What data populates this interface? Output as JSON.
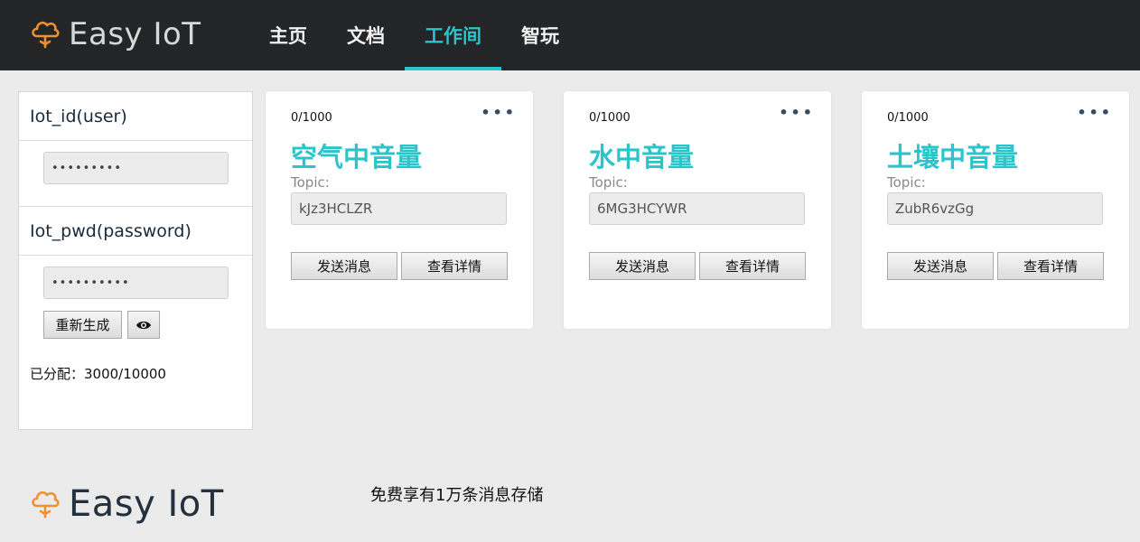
{
  "app": {
    "name": "Easy IoT",
    "brand_color": "#2cc4cb",
    "logo_color": "#f0902e"
  },
  "nav": {
    "items": [
      {
        "label": "主页",
        "active": false
      },
      {
        "label": "文档",
        "active": false
      },
      {
        "label": "工作间",
        "active": true
      },
      {
        "label": "智玩",
        "active": false
      }
    ]
  },
  "account": {
    "user_label": "Iot_id(user)",
    "user_value": "•••••••••",
    "pwd_label": "Iot_pwd(password)",
    "pwd_value": "••••••••••",
    "regenerate_label": "重新生成",
    "reveal_icon": "eye-icon",
    "allocation_text": "已分配：3000/10000"
  },
  "cards": [
    {
      "count": "0/1000",
      "title": "空气中音量",
      "topic_label": "Topic:",
      "topic": "kJz3HCLZR",
      "send_label": "发送消息",
      "detail_label": "查看详情"
    },
    {
      "count": "0/1000",
      "title": "水中音量",
      "topic_label": "Topic:",
      "topic": "6MG3HCYWR",
      "send_label": "发送消息",
      "detail_label": "查看详情"
    },
    {
      "count": "0/1000",
      "title": "土壤中音量",
      "topic_label": "Topic:",
      "topic": "ZubR6vzGg",
      "send_label": "发送消息",
      "detail_label": "查看详情"
    }
  ],
  "card_menu": "•••",
  "footer": {
    "logo_text": "Easy IoT",
    "tagline": "免费享有1万条消息存储"
  }
}
